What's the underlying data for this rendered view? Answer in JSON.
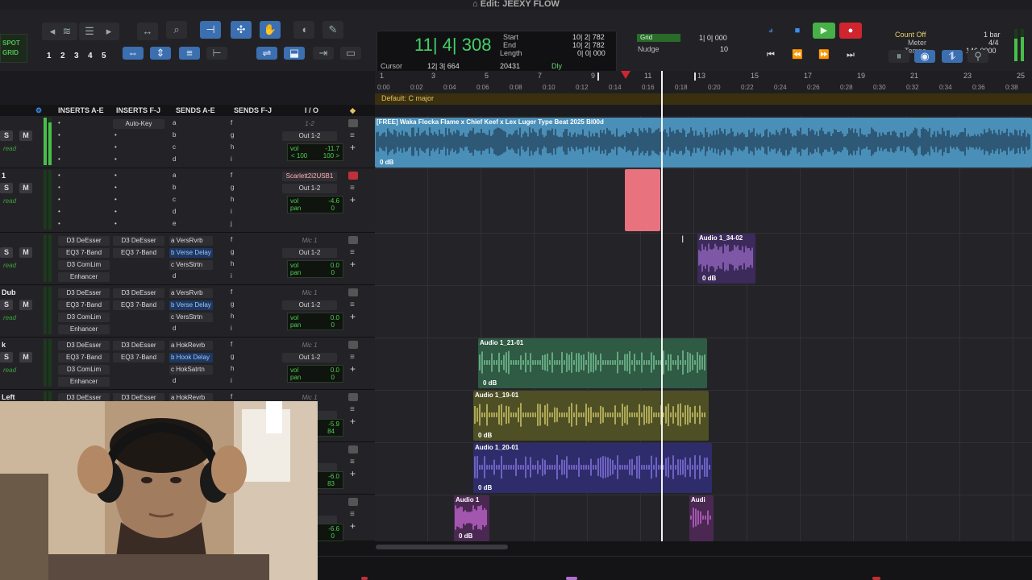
{
  "window": {
    "title": "Edit: JEEXY FLOW"
  },
  "toolbar": {
    "mode_spot": "SPOT",
    "mode_grid": "GRID",
    "zoom_presets": [
      "1",
      "2",
      "3",
      "4",
      "5"
    ],
    "counter": {
      "main": "11| 4| 308",
      "start_label": "Start",
      "end_label": "End",
      "length_label": "Length",
      "start": "10| 2| 782",
      "end": "10| 2| 782",
      "length": "0| 0| 000",
      "cursor_label": "Cursor",
      "cursor": "12| 3| 664",
      "samples": "20431",
      "dly": "Dly"
    },
    "grid_label": "Grid",
    "grid_value": "1| 0| 000",
    "nudge_label": "Nudge",
    "nudge_value": "10",
    "count_off": "Count Off",
    "meter_label": "Meter",
    "tempo_label": "Tempo",
    "bar_count": "1 bar",
    "meter_value": "4/4",
    "tempo_value": "146.0000",
    "accent": "#3b6fb0",
    "record_color": "#d0252e"
  },
  "ruler": {
    "bars": [
      "1",
      "3",
      "5",
      "7",
      "9",
      "11",
      "13",
      "15",
      "17",
      "19",
      "21",
      "23",
      "25"
    ],
    "times": [
      "0:00",
      "0:02",
      "0:04",
      "0:06",
      "0:08",
      "0:10",
      "0:12",
      "0:14",
      "0:16",
      "0:18",
      "0:20",
      "0:22",
      "0:24",
      "0:26",
      "0:28",
      "0:30",
      "0:32",
      "0:34",
      "0:36",
      "0:38"
    ],
    "key_signature": "Default: C major",
    "marker_11_label": "11",
    "marker_13_label": "13"
  },
  "mixer_header": {
    "col1": "INSERTS A-E",
    "col2": "INSERTS F-J",
    "col3": "SENDS A-E",
    "col4": "SENDS F-J",
    "col5": "I / O"
  },
  "tracks": [
    {
      "name": "",
      "ins_a": [
        "",
        "",
        "",
        "",
        ""
      ],
      "ins_b": [
        "Auto-Key",
        "",
        "",
        "",
        ""
      ],
      "sends_a": [
        "a",
        "b",
        "c",
        "d"
      ],
      "sends_b": [
        "f",
        "g",
        "h",
        "i"
      ],
      "io_in": "1-2",
      "io_out": "Out 1-2",
      "vol": "-11.7",
      "pan_l": "< 100",
      "pan_r": "100 >",
      "vol_lbl": "vol",
      "read": "read"
    },
    {
      "name": "1",
      "ins_a": [
        "",
        "",
        "",
        "",
        ""
      ],
      "ins_b": [
        "",
        "",
        "",
        "",
        ""
      ],
      "sends_a": [
        "a",
        "b",
        "c",
        "d",
        "e"
      ],
      "sends_b": [
        "f",
        "g",
        "h",
        "i",
        "j"
      ],
      "io_in": "Scarlett2i2USB1",
      "io_out": "Out 1-2",
      "vol": "-4.6",
      "pan": "0",
      "vol_lbl": "vol",
      "pan_lbl": "pan",
      "read": "read"
    },
    {
      "name": "",
      "ins_a": [
        "D3 DeEsser",
        "EQ3 7-Band",
        "D3 ComLim",
        "Enhancer"
      ],
      "ins_b": [
        "D3 DeEsser",
        "EQ3 7-Band"
      ],
      "sends_a": [
        "a VersRvrb",
        "b Verse Delay",
        "c VersStrtn",
        "d"
      ],
      "sends_b": [
        "f",
        "g",
        "h",
        "i"
      ],
      "io_in": "Mic 1",
      "io_out": "Out 1-2",
      "vol": "0.0",
      "pan": "0",
      "vol_lbl": "vol",
      "pan_lbl": "pan",
      "read": "read"
    },
    {
      "name": "Dub",
      "ins_a": [
        "D3 DeEsser",
        "EQ3 7-Band",
        "D3 ComLim",
        "Enhancer"
      ],
      "ins_b": [
        "D3 DeEsser",
        "EQ3 7-Band"
      ],
      "sends_a": [
        "a VersRvrb",
        "b Verse Delay",
        "c VersStrtn",
        "d"
      ],
      "sends_b": [
        "f",
        "g",
        "h",
        "i"
      ],
      "io_in": "Mic 1",
      "io_out": "Out 1-2",
      "vol": "0.0",
      "pan": "0",
      "vol_lbl": "vol",
      "pan_lbl": "pan",
      "read": "read"
    },
    {
      "name": "k",
      "ins_a": [
        "D3 DeEsser",
        "EQ3 7-Band",
        "D3 ComLim",
        "Enhancer"
      ],
      "ins_b": [
        "D3 DeEsser",
        "EQ3 7-Band"
      ],
      "sends_a": [
        "a HokRevrb",
        "b Hook Delay",
        "c HokSatrtn",
        "d"
      ],
      "sends_b": [
        "f",
        "g",
        "h",
        "i"
      ],
      "io_in": "Mic 1",
      "io_out": "Out 1-2",
      "vol": "0.0",
      "pan": "0",
      "vol_lbl": "vol",
      "pan_lbl": "pan",
      "read": "read"
    },
    {
      "name": "Left",
      "ins_a": [
        "D3 DeEsser"
      ],
      "ins_b": [
        "D3 DeEsser"
      ],
      "sends_a": [
        "a HokRevrb"
      ],
      "sends_b": [
        "f"
      ],
      "io_in": "Mic 1",
      "io_out": "2",
      "vol": "-5.9",
      "pan": "84"
    },
    {
      "name": "",
      "io_out": "2",
      "vol": "-6.0",
      "pan": "83"
    },
    {
      "name": "",
      "io_out": "2",
      "vol": "-6.6",
      "pan": "0"
    }
  ],
  "clips": {
    "beat_name": "[FREE] Waka Flocka Flame x Chief Keef x Lex Luger Type Beat 2025 Bl00d",
    "beat_gain": "0 dB",
    "clip_34": "Audio 1_34-02",
    "clip_34_gain": "0 dB",
    "clip_21": "Audio 1_21-01",
    "clip_21_gain": "0 dB",
    "clip_19": "Audio 1_19-01",
    "clip_19_gain": "0 dB",
    "clip_20": "Audio 1_20-01",
    "clip_20_gain": "0 dB",
    "clip_a1": "Audio 1",
    "clip_a1_gain": "0 dB",
    "clip_aud": "Audi",
    "colors": {
      "beat": "#4a8fb8",
      "rec": "#e8727e",
      "purple1": "#3c2a5a",
      "green": "#2f5a44",
      "olive": "#4e4f24",
      "blue_purple": "#2e2c6a",
      "magenta": "#4a2852"
    }
  }
}
